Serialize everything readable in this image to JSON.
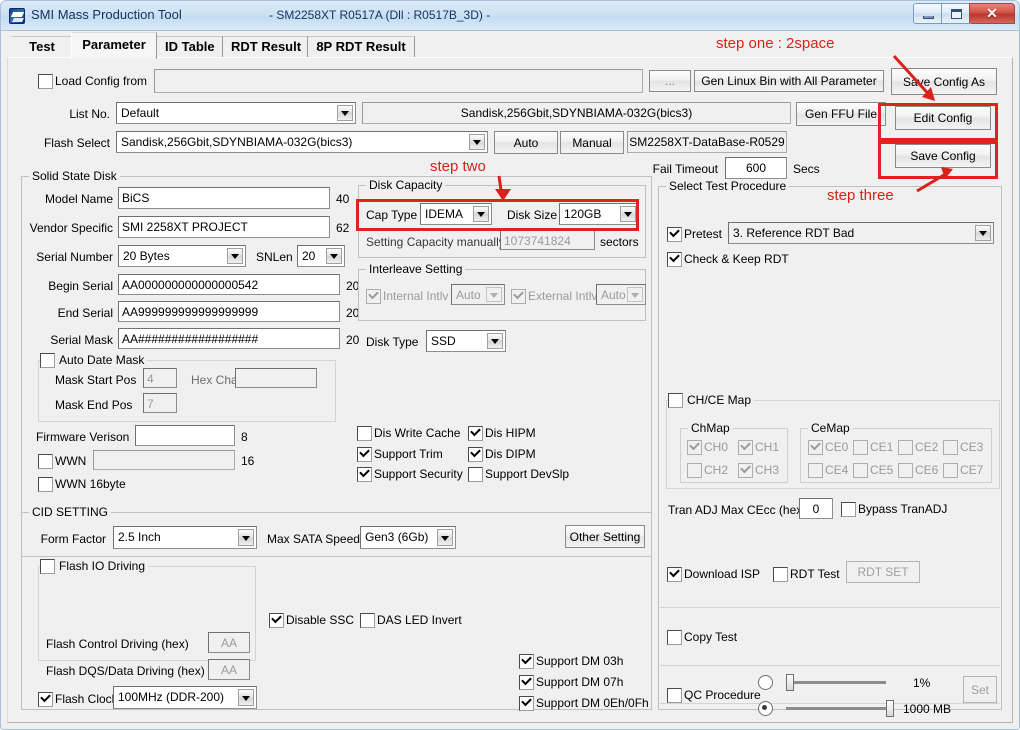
{
  "window": {
    "icon": "app-icon",
    "title": "SMI Mass Production Tool",
    "subtitle": "- SM2258XT    R0517A     (Dll : R0517B_3D) -",
    "buttons": {
      "minimize": "minimize-icon",
      "maximize": "maximize-icon",
      "close": "✕"
    }
  },
  "tabs": [
    {
      "label": "Test",
      "selected": false
    },
    {
      "label": "Parameter",
      "selected": true
    },
    {
      "label": "ID Table",
      "selected": false
    },
    {
      "label": "RDT Result",
      "selected": false
    },
    {
      "label": "8P RDT Result",
      "selected": false
    }
  ],
  "annotations": {
    "step_one": "step one : 2space",
    "step_two": "step two",
    "step_three": "step three",
    "accent_color": "#d8221c"
  },
  "top": {
    "load_config_from": {
      "label": "Load Config from",
      "checked": false,
      "value": ""
    },
    "browse_button": "...",
    "gen_linux_bin": "Gen Linux Bin with All Parameter",
    "save_config_as": "Save Config As",
    "list_no": {
      "label": "List No.",
      "value": "Default"
    },
    "flash_info": "Sandisk,256Gbit,SDYNBIAMA-032G(bics3)",
    "gen_ffu_file": "Gen FFU File",
    "edit_config": "Edit Config",
    "flash_select": {
      "label": "Flash Select",
      "value": "Sandisk,256Gbit,SDYNBIAMA-032G(bics3)"
    },
    "auto_button": "Auto",
    "manual_button": "Manual",
    "database": "SM2258XT-DataBase-R0529",
    "save_config": "Save Config",
    "fail_timeout": {
      "label": "Fail Timeout",
      "value": "600",
      "unit": "Secs"
    }
  },
  "solid_state_disk": {
    "caption": "Solid State Disk",
    "model_name": {
      "label": "Model Name",
      "value": "BiCS",
      "len": "40"
    },
    "vendor_specific": {
      "label": "Vendor Specific",
      "value": "SMI 2258XT PROJECT",
      "len": "62"
    },
    "serial_number": {
      "label": "Serial Number",
      "value": "20 Bytes",
      "snlen_label": "SNLen",
      "snlen": "20"
    },
    "begin_serial": {
      "label": "Begin Serial",
      "value": "AA000000000000000542",
      "len": "20"
    },
    "end_serial": {
      "label": "End Serial",
      "value": "AA999999999999999999",
      "len": "20"
    },
    "serial_mask": {
      "label": "Serial Mask",
      "value": "AA##################",
      "len": "20"
    },
    "auto_date_mask": {
      "label": "Auto Date Mask",
      "checked": false
    },
    "mask_start_pos": {
      "label": "Mask Start Pos",
      "value": "4"
    },
    "mask_end_pos": {
      "label": "Mask End Pos",
      "value": "7"
    },
    "hex_char": {
      "label": "Hex Char:",
      "value": ""
    },
    "firmware_version": {
      "label": "Firmware Verison",
      "value": "",
      "len": "8"
    },
    "wwn": {
      "label": "WWN",
      "checked": false,
      "value": "",
      "len": "16"
    },
    "wwn_16byte": {
      "label": "WWN 16byte",
      "checked": false
    },
    "flags": [
      {
        "label": "Dis Write Cache",
        "checked": false
      },
      {
        "label": "Support Trim",
        "checked": true
      },
      {
        "label": "Support Security",
        "checked": true
      },
      {
        "label": "Dis HIPM",
        "checked": true
      },
      {
        "label": "Dis DIPM",
        "checked": true
      },
      {
        "label": "Support DevSlp",
        "checked": false
      }
    ]
  },
  "disk_capacity": {
    "caption": "Disk Capacity",
    "cap_type": {
      "label": "Cap Type",
      "value": "IDEMA"
    },
    "disk_size": {
      "label": "Disk Size",
      "value": "120GB"
    },
    "setting_capacity": {
      "label": "Setting Capacity manually",
      "value": "1073741824",
      "unit": "sectors"
    }
  },
  "interleave": {
    "caption": "Interleave Setting",
    "internal": {
      "label": "Internal Intlv",
      "checked": true,
      "value": "Auto"
    },
    "external": {
      "label": "External Intlv",
      "checked": true,
      "value": "Auto"
    }
  },
  "disk_type": {
    "label": "Disk Type",
    "value": "SSD"
  },
  "cid_setting": {
    "caption": "CID SETTING",
    "form_factor": {
      "label": "Form Factor",
      "value": "2.5 Inch"
    },
    "max_sata_speed": {
      "label": "Max SATA Speed",
      "value": "Gen3 (6Gb)"
    },
    "other_setting": "Other Setting",
    "disable_ssc": {
      "label": "Disable SSC",
      "checked": true
    },
    "das_led_invert": {
      "label": "DAS LED Invert",
      "checked": false
    },
    "flash_io_driving": {
      "label": "Flash IO Driving",
      "checked": false
    },
    "flash_control_driving": {
      "label": "Flash Control Driving (hex)",
      "value": "AA"
    },
    "flash_dqs_driving": {
      "label": "Flash DQS/Data Driving (hex)",
      "value": "AA"
    },
    "flash_clock": {
      "label": "Flash Clock",
      "checked": true,
      "value": "100MHz (DDR-200)"
    },
    "support_dm": [
      {
        "label": "Support DM 03h",
        "checked": true
      },
      {
        "label": "Support DM 07h",
        "checked": true
      },
      {
        "label": "Support DM 0Eh/0Fh",
        "checked": true
      }
    ]
  },
  "test_procedure": {
    "caption": "Select Test Procedure",
    "pretest": {
      "label": "Pretest",
      "checked": true,
      "value": "3. Reference RDT Bad"
    },
    "check_keep_rdt": {
      "label": "Check & Keep RDT",
      "checked": true
    },
    "chce_map": {
      "label": "CH/CE Map",
      "checked": false
    },
    "chmap": {
      "caption": "ChMap",
      "items": [
        {
          "label": "CH0",
          "checked": true
        },
        {
          "label": "CH1",
          "checked": true
        },
        {
          "label": "CH2",
          "checked": false
        },
        {
          "label": "CH3",
          "checked": true
        }
      ]
    },
    "cemap": {
      "caption": "CeMap",
      "items": [
        {
          "label": "CE0",
          "checked": true
        },
        {
          "label": "CE1",
          "checked": false
        },
        {
          "label": "CE2",
          "checked": false
        },
        {
          "label": "CE3",
          "checked": false
        },
        {
          "label": "CE4",
          "checked": false
        },
        {
          "label": "CE5",
          "checked": false
        },
        {
          "label": "CE6",
          "checked": false
        },
        {
          "label": "CE7",
          "checked": false
        }
      ]
    },
    "tran_adj": {
      "label": "Tran ADJ Max CEcc (hex)",
      "value": "0"
    },
    "bypass_tranadj": {
      "label": "Bypass TranADJ",
      "checked": false
    },
    "download_isp": {
      "label": "Download ISP",
      "checked": true
    },
    "rdt_test": {
      "label": "RDT Test",
      "checked": false
    },
    "rdt_set_button": "RDT SET",
    "copy_test": {
      "label": "Copy Test",
      "checked": false
    },
    "copy_percent": {
      "value": "1%",
      "selected": false,
      "fill": 2
    },
    "copy_size": {
      "value": "1000 MB",
      "selected": true,
      "fill": 98
    },
    "set_button": "Set",
    "qc_procedure": {
      "label": "QC Procedure",
      "checked": false
    }
  }
}
